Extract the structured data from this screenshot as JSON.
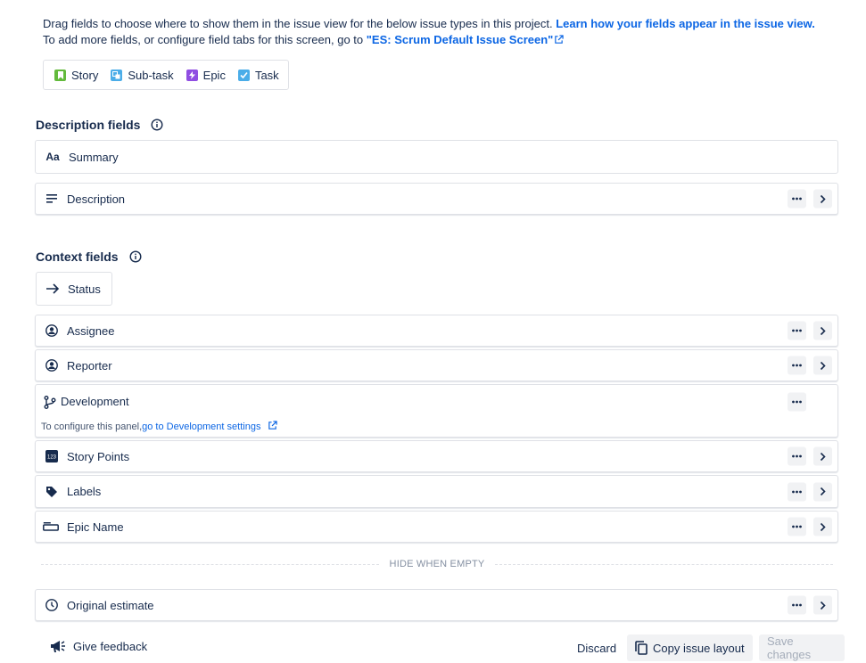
{
  "intro": {
    "line1": "Drag fields to choose where to show them in the issue view for the below issue types in this project.",
    "learn_link": "Learn how your fields appear in the issue view.",
    "line2": "To add more fields, or configure field tabs for this screen, go to",
    "screen_link": "\"ES: Scrum Default Issue Screen\""
  },
  "issue_types": [
    {
      "label": "Story",
      "icon": "story-icon",
      "color": "#63ba3c"
    },
    {
      "label": "Sub-task",
      "icon": "subtask-icon",
      "color": "#4bade8"
    },
    {
      "label": "Epic",
      "icon": "epic-icon",
      "color": "#904ee2"
    },
    {
      "label": "Task",
      "icon": "task-icon",
      "color": "#4bade8"
    }
  ],
  "description_section": {
    "title": "Description fields",
    "fields": [
      {
        "label": "Summary",
        "icon": "text-icon"
      },
      {
        "label": "Description",
        "icon": "paragraph-icon"
      }
    ]
  },
  "context_section": {
    "title": "Context fields",
    "status": "Status",
    "fields": [
      {
        "label": "Assignee",
        "icon": "person-icon"
      },
      {
        "label": "Reporter",
        "icon": "person-icon"
      },
      {
        "label": "Development",
        "icon": "branch-icon"
      },
      {
        "label": "Story Points",
        "icon": "number-icon"
      },
      {
        "label": "Labels",
        "icon": "tag-icon"
      },
      {
        "label": "Epic Name",
        "icon": "short-text-icon"
      }
    ],
    "development_note": "To configure this panel,",
    "development_link": "go to Development settings"
  },
  "hide_when_empty": {
    "label": "HIDE WHEN EMPTY",
    "fields": [
      {
        "label": "Original estimate",
        "icon": "clock-icon"
      }
    ]
  },
  "footer": {
    "feedback": "Give feedback",
    "discard": "Discard",
    "copy": "Copy issue layout",
    "save": "Save changes"
  },
  "colors": {
    "link": "#0c66e4",
    "text": "#172b4d",
    "border": "#dfe1e6"
  }
}
